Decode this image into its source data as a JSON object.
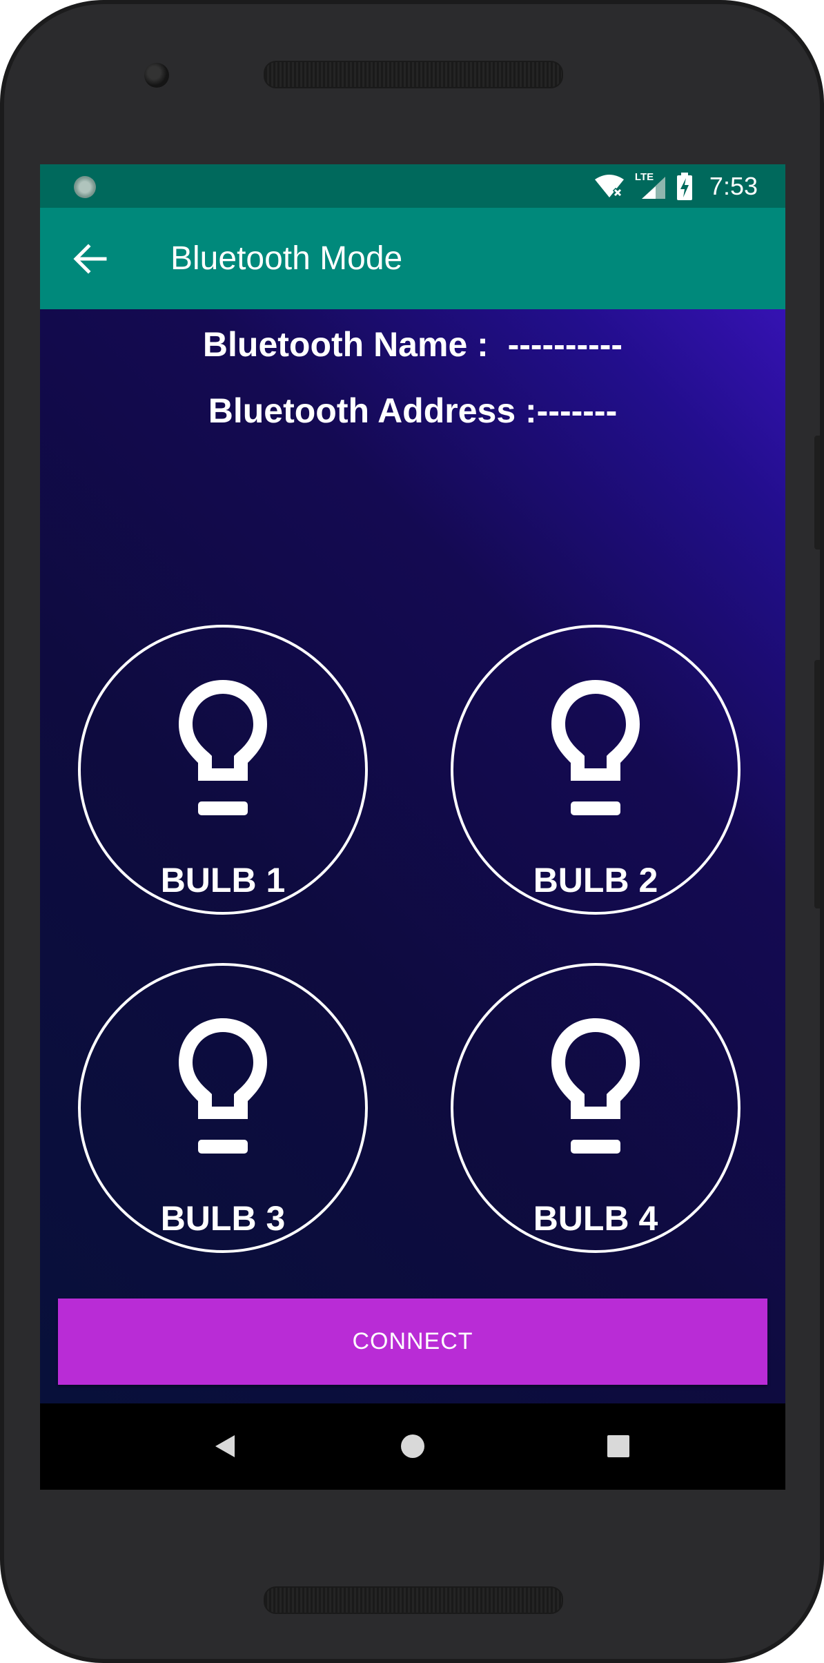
{
  "status_bar": {
    "time": "7:53",
    "icons": [
      "loading-circle-icon",
      "wifi-off-icon",
      "lte-signal-icon",
      "battery-charging-icon"
    ],
    "network_label": "LTE"
  },
  "app_bar": {
    "back_icon": "arrow-back-icon",
    "title": "Bluetooth Mode"
  },
  "info": {
    "name_line": "Bluetooth Name :  ----------",
    "address_line": "Bluetooth Address :-------"
  },
  "bulbs": [
    {
      "label": "BULB 1",
      "icon": "lightbulb-icon"
    },
    {
      "label": "BULB 2",
      "icon": "lightbulb-icon"
    },
    {
      "label": "BULB 3",
      "icon": "lightbulb-icon"
    },
    {
      "label": "BULB 4",
      "icon": "lightbulb-icon"
    }
  ],
  "connect_button": {
    "label": "CONNECT"
  },
  "nav_bar": {
    "items": [
      "nav-back-icon",
      "nav-home-icon",
      "nav-recents-icon"
    ]
  },
  "colors": {
    "status_bar": "#00695c",
    "app_bar": "#00897b",
    "connect_button": "#b92cd6",
    "background_top": "#3512b2",
    "background_bottom": "#08103a"
  }
}
